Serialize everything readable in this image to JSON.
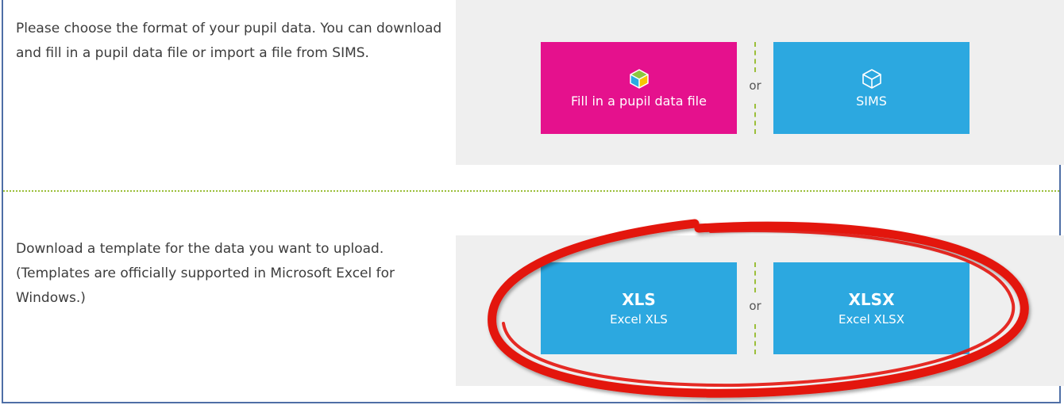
{
  "section1": {
    "instructions": "Please choose the format of your pupil data. You can download and fill in a pupil data file or import a file from SIMS.",
    "fill_button_label": "Fill in a pupil data file",
    "or_label": "or",
    "sims_button_label": "SIMS"
  },
  "section2": {
    "instructions": "Download a template for the data you want to upload. (Templates are officially supported in Microsoft Excel for Windows.)",
    "xls_title": "XLS",
    "xls_subtitle": "Excel XLS",
    "or_label": "or",
    "xlsx_title": "XLSX",
    "xlsx_subtitle": "Excel XLSX"
  },
  "icons": {
    "fill_icon": "colored-cube-icon",
    "sims_icon": "cube-outline-icon"
  },
  "colors": {
    "fill_tile": "#e5118d",
    "blue_tile": "#2ca8e0",
    "panel_bg": "#efefef",
    "separator": "#9bbf3a",
    "annotation_circle": "#e3140d"
  }
}
